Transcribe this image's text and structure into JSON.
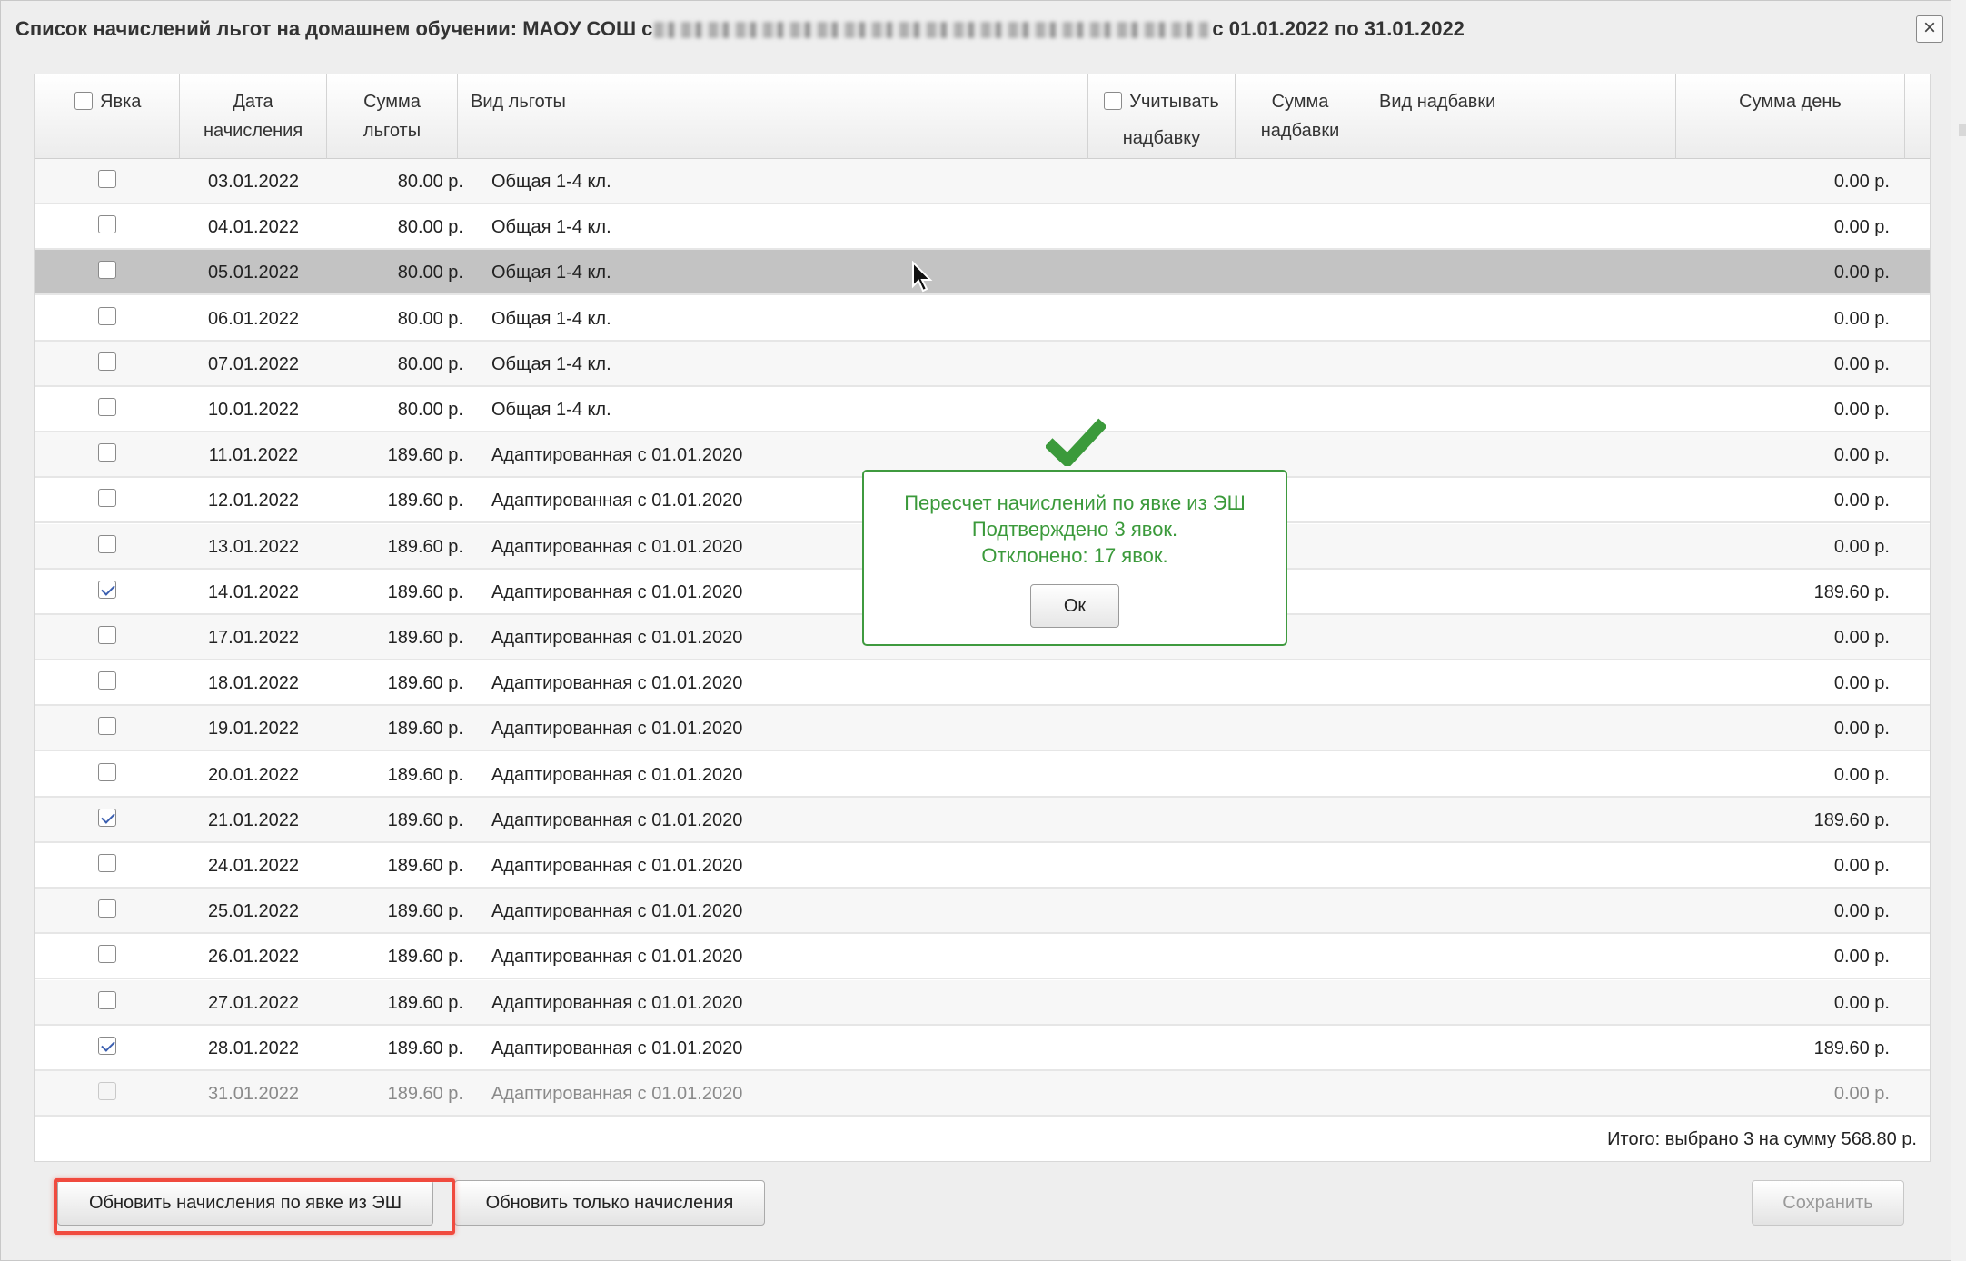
{
  "window": {
    "title_prefix": "Список начислений льгот на домашнем обучении: МАОУ СОШ с",
    "title_suffix": "с 01.01.2022 по 31.01.2022",
    "close_label": "×"
  },
  "table": {
    "headers": {
      "attendance": "Явка",
      "date": "Дата начисления",
      "benefit_sum": "Сумма льготы",
      "benefit_kind": "Вид льготы",
      "consider_surcharge": "Учитывать надбавку",
      "surcharge_sum": "Сумма надбавки",
      "surcharge_kind": "Вид надбавки",
      "day_sum": "Сумма день"
    },
    "rows": [
      {
        "checked": false,
        "date": "03.01.2022",
        "sum": "80.00 р.",
        "kind": "Общая 1-4 кл.",
        "day_sum": "0.00 р."
      },
      {
        "checked": false,
        "date": "04.01.2022",
        "sum": "80.00 р.",
        "kind": "Общая 1-4 кл.",
        "day_sum": "0.00 р."
      },
      {
        "checked": false,
        "date": "05.01.2022",
        "sum": "80.00 р.",
        "kind": "Общая 1-4 кл.",
        "day_sum": "0.00 р."
      },
      {
        "checked": false,
        "date": "06.01.2022",
        "sum": "80.00 р.",
        "kind": "Общая 1-4 кл.",
        "day_sum": "0.00 р."
      },
      {
        "checked": false,
        "date": "07.01.2022",
        "sum": "80.00 р.",
        "kind": "Общая 1-4 кл.",
        "day_sum": "0.00 р."
      },
      {
        "checked": false,
        "date": "10.01.2022",
        "sum": "80.00 р.",
        "kind": "Общая 1-4 кл.",
        "day_sum": "0.00 р."
      },
      {
        "checked": false,
        "date": "11.01.2022",
        "sum": "189.60 р.",
        "kind": "Адаптированная с 01.01.2020",
        "day_sum": "0.00 р."
      },
      {
        "checked": false,
        "date": "12.01.2022",
        "sum": "189.60 р.",
        "kind": "Адаптированная с 01.01.2020",
        "day_sum": "0.00 р."
      },
      {
        "checked": false,
        "date": "13.01.2022",
        "sum": "189.60 р.",
        "kind": "Адаптированная с 01.01.2020",
        "day_sum": "0.00 р."
      },
      {
        "checked": true,
        "date": "14.01.2022",
        "sum": "189.60 р.",
        "kind": "Адаптированная с 01.01.2020",
        "day_sum": "189.60 р."
      },
      {
        "checked": false,
        "date": "17.01.2022",
        "sum": "189.60 р.",
        "kind": "Адаптированная с 01.01.2020",
        "day_sum": "0.00 р."
      },
      {
        "checked": false,
        "date": "18.01.2022",
        "sum": "189.60 р.",
        "kind": "Адаптированная с 01.01.2020",
        "day_sum": "0.00 р."
      },
      {
        "checked": false,
        "date": "19.01.2022",
        "sum": "189.60 р.",
        "kind": "Адаптированная с 01.01.2020",
        "day_sum": "0.00 р."
      },
      {
        "checked": false,
        "date": "20.01.2022",
        "sum": "189.60 р.",
        "kind": "Адаптированная с 01.01.2020",
        "day_sum": "0.00 р."
      },
      {
        "checked": true,
        "date": "21.01.2022",
        "sum": "189.60 р.",
        "kind": "Адаптированная с 01.01.2020",
        "day_sum": "189.60 р."
      },
      {
        "checked": false,
        "date": "24.01.2022",
        "sum": "189.60 р.",
        "kind": "Адаптированная с 01.01.2020",
        "day_sum": "0.00 р."
      },
      {
        "checked": false,
        "date": "25.01.2022",
        "sum": "189.60 р.",
        "kind": "Адаптированная с 01.01.2020",
        "day_sum": "0.00 р."
      },
      {
        "checked": false,
        "date": "26.01.2022",
        "sum": "189.60 р.",
        "kind": "Адаптированная с 01.01.2020",
        "day_sum": "0.00 р."
      },
      {
        "checked": false,
        "date": "27.01.2022",
        "sum": "189.60 р.",
        "kind": "Адаптированная с 01.01.2020",
        "day_sum": "0.00 р."
      },
      {
        "checked": true,
        "date": "28.01.2022",
        "sum": "189.60 р.",
        "kind": "Адаптированная с 01.01.2020",
        "day_sum": "189.60 р."
      },
      {
        "checked": false,
        "disabled": true,
        "date": "31.01.2022",
        "sum": "189.60 р.",
        "kind": "Адаптированная с 01.01.2020",
        "day_sum": "0.00 р."
      }
    ],
    "hover_row_index": 2,
    "total": "Итого: выбрано 3 на сумму 568.80 р."
  },
  "buttons": {
    "update_by_attendance": "Обновить начисления по явке из ЭШ",
    "update_only": "Обновить только начисления",
    "save": "Сохранить"
  },
  "toast": {
    "line1": "Пересчет начислений по явке из ЭШ",
    "line2": "Подтверждено 3 явок.",
    "line3": "Отклонено: 17 явок.",
    "ok_label": "Ок"
  },
  "colors": {
    "success_green": "#3b9a3b",
    "highlight_red": "#f04a3e",
    "hover_row": "#c3c3c3",
    "checkbox_check": "#3b5fb0"
  },
  "icons": {
    "toast_icon": "checkmark-icon",
    "cursor": "mouse-pointer-icon"
  }
}
